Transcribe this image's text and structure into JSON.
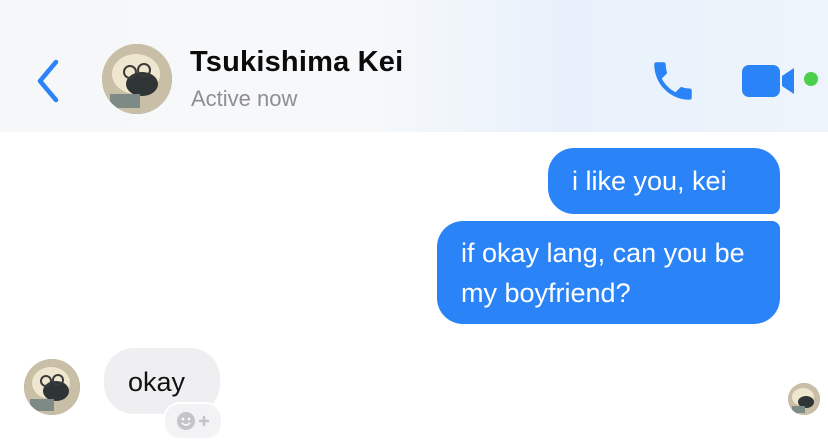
{
  "header": {
    "back_icon": "chevron-left-icon",
    "contact_name": "Tsukishima Kei",
    "status": "Active now",
    "call_icon": "phone-icon",
    "video_icon": "video-camera-icon",
    "online_color": "#4bd04b",
    "accent_color": "#2b84f7"
  },
  "messages": [
    {
      "direction": "outgoing",
      "text": "i like you, kei"
    },
    {
      "direction": "outgoing",
      "text": "if okay lang, can you be my boyfriend?"
    },
    {
      "direction": "incoming",
      "text": "okay"
    }
  ],
  "reaction_icon": "add-reaction-icon",
  "colors": {
    "outgoing_bubble": "#2b84f7",
    "incoming_bubble": "#efeff1"
  }
}
